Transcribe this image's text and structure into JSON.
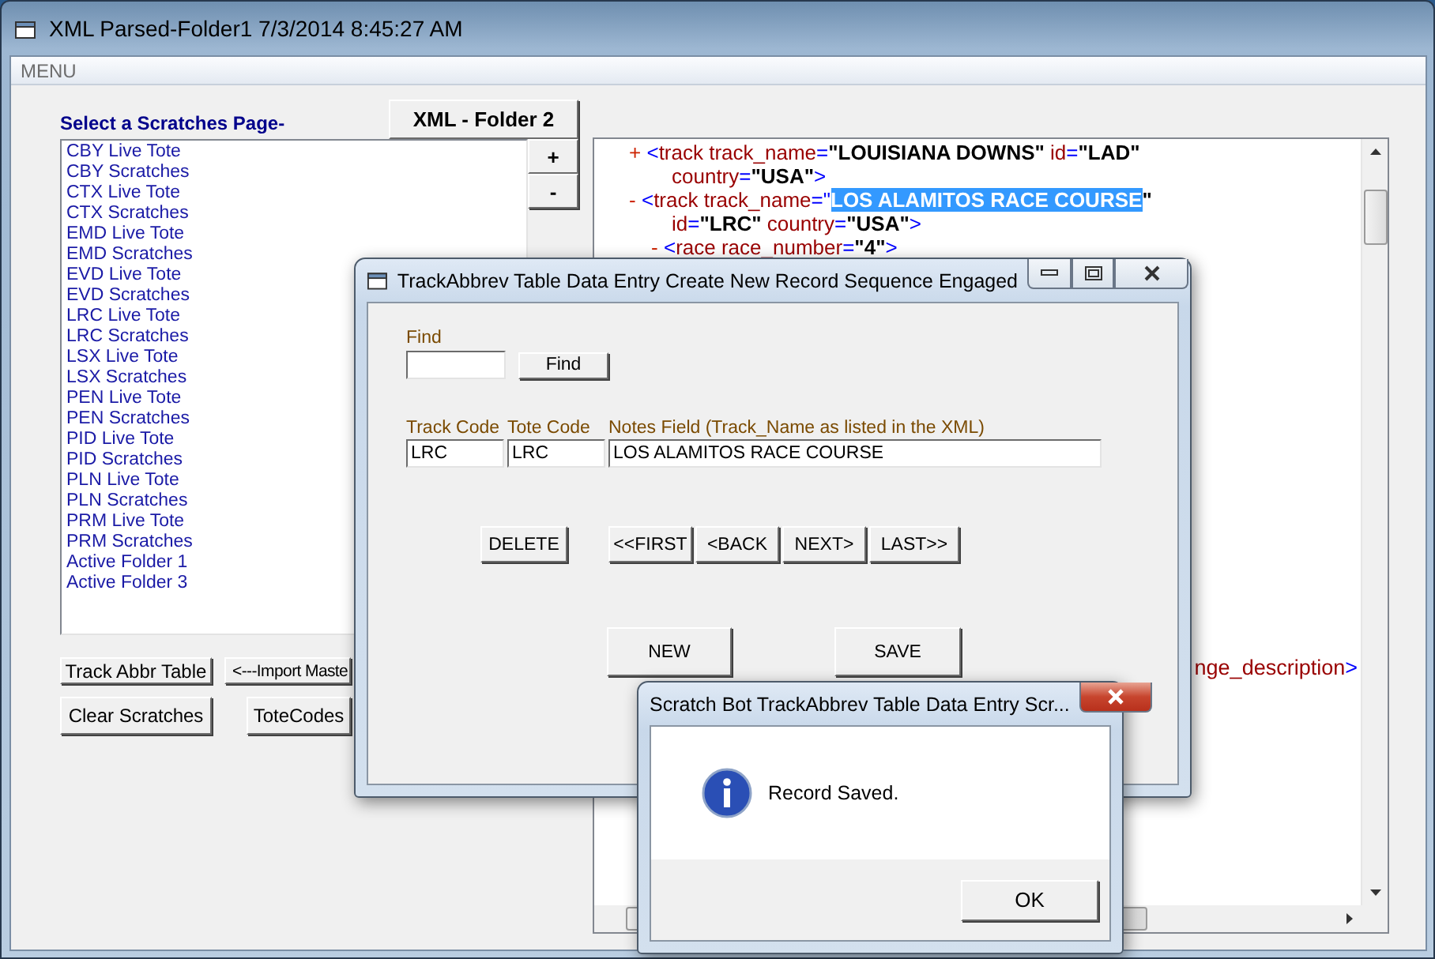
{
  "main_window": {
    "title": "XML Parsed-Folder1 7/3/2014 8:45:27 AM",
    "menu": [
      "MENU"
    ],
    "list_heading": "Select a Scratches Page-",
    "folder_button": "XML - Folder 2",
    "pages": [
      {
        "label": "CBY Live Tote",
        "selected": false
      },
      {
        "label": "CBY Scratches",
        "selected": false
      },
      {
        "label": "CTX Live Tote",
        "selected": false
      },
      {
        "label": "CTX Scratches",
        "selected": false
      },
      {
        "label": "EMD Live Tote",
        "selected": false
      },
      {
        "label": "EMD Scratches",
        "selected": false
      },
      {
        "label": "EVD Live Tote",
        "selected": false
      },
      {
        "label": "EVD Scratches",
        "selected": false
      },
      {
        "label": "LRC Live Tote",
        "selected": false
      },
      {
        "label": "LRC Scratches",
        "selected": false
      },
      {
        "label": "LSX Live Tote",
        "selected": false
      },
      {
        "label": "LSX Scratches",
        "selected": false
      },
      {
        "label": "PEN Live Tote",
        "selected": false
      },
      {
        "label": "PEN Scratches",
        "selected": false
      },
      {
        "label": "PID Live Tote",
        "selected": false
      },
      {
        "label": "PID Scratches",
        "selected": false
      },
      {
        "label": "PLN Live Tote",
        "selected": false
      },
      {
        "label": "PLN Scratches",
        "selected": false
      },
      {
        "label": "PRM Live Tote",
        "selected": false
      },
      {
        "label": "PRM Scratches",
        "selected": false
      },
      {
        "label": "Active Folder 1",
        "selected": false
      },
      {
        "label": "Active Folder 3",
        "selected": false
      }
    ],
    "list_buttons": [
      "+",
      "-"
    ],
    "action_rows": [
      [
        "Track Abbr Table",
        "<---Import Maste"
      ],
      [
        "Clear Scratches",
        "ToteCodes"
      ]
    ],
    "xml_tree": [
      {
        "toggle": "+",
        "segments": [
          {
            "text": "<",
            "kind": "punct"
          },
          {
            "text": "track",
            "kind": "tag"
          },
          {
            "text": " track_name",
            "kind": "attr"
          },
          {
            "text": "=",
            "kind": "punct"
          },
          {
            "text": "\"LOUISIANA DOWNS\"",
            "kind": "value"
          },
          {
            "text": " id",
            "kind": "attr"
          },
          {
            "text": "=",
            "kind": "punct"
          },
          {
            "text": "\"LAD\"",
            "kind": "value"
          }
        ],
        "wrap": [
          {
            "text": "country",
            "kind": "attr"
          },
          {
            "text": "=",
            "kind": "punct"
          },
          {
            "text": "\"USA\"",
            "kind": "value"
          },
          {
            "text": ">",
            "kind": "punct"
          }
        ]
      },
      {
        "toggle": "-",
        "segments": [
          {
            "text": "<",
            "kind": "punct"
          },
          {
            "text": "track",
            "kind": "tag"
          },
          {
            "text": " track_name",
            "kind": "attr"
          },
          {
            "text": "=\"",
            "kind": "punct"
          },
          {
            "text": "LOS ALAMITOS RACE COURSE",
            "kind": "selected"
          },
          {
            "text": "\"",
            "kind": "value"
          }
        ],
        "wrap": [
          {
            "text": "id",
            "kind": "attr"
          },
          {
            "text": "=",
            "kind": "punct"
          },
          {
            "text": "\"LRC\"",
            "kind": "value"
          },
          {
            "text": " country",
            "kind": "attr"
          },
          {
            "text": "=",
            "kind": "punct"
          },
          {
            "text": "\"USA\"",
            "kind": "value"
          },
          {
            "text": ">",
            "kind": "punct"
          }
        ],
        "children": [
          {
            "toggle": "-",
            "segments": [
              {
                "text": "<",
                "kind": "punct"
              },
              {
                "text": "race",
                "kind": "tag"
              },
              {
                "text": " race_number",
                "kind": "attr"
              },
              {
                "text": "=",
                "kind": "punct"
              },
              {
                "text": "\"4\"",
                "kind": "value"
              },
              {
                "text": ">",
                "kind": "punct"
              }
            ]
          }
        ]
      }
    ],
    "xml_fragment": [
      {
        "text": "nge_description",
        "kind": "attr"
      },
      {
        "text": ">",
        "kind": "punct"
      }
    ]
  },
  "entry_dialog": {
    "title": "TrackAbbrev Table Data Entry Create New Record Sequence Engaged",
    "find_label": "Find",
    "find_button": "Find",
    "fields": [
      {
        "label": "Track Code",
        "value": "LRC"
      },
      {
        "label": "Tote Code",
        "value": "LRC"
      },
      {
        "label": "Notes Field (Track_Name as listed in the XML)",
        "value": "LOS ALAMITOS RACE COURSE"
      }
    ],
    "delete_button": "DELETE",
    "nav_buttons": [
      "<<FIRST",
      "<BACK",
      "NEXT>",
      "LAST>>"
    ],
    "new_button": "NEW",
    "save_button": "SAVE"
  },
  "message_box": {
    "title": "Scratch Bot TrackAbbrev Table Data Entry Scr...",
    "message": "Record Saved.",
    "button": "OK"
  }
}
